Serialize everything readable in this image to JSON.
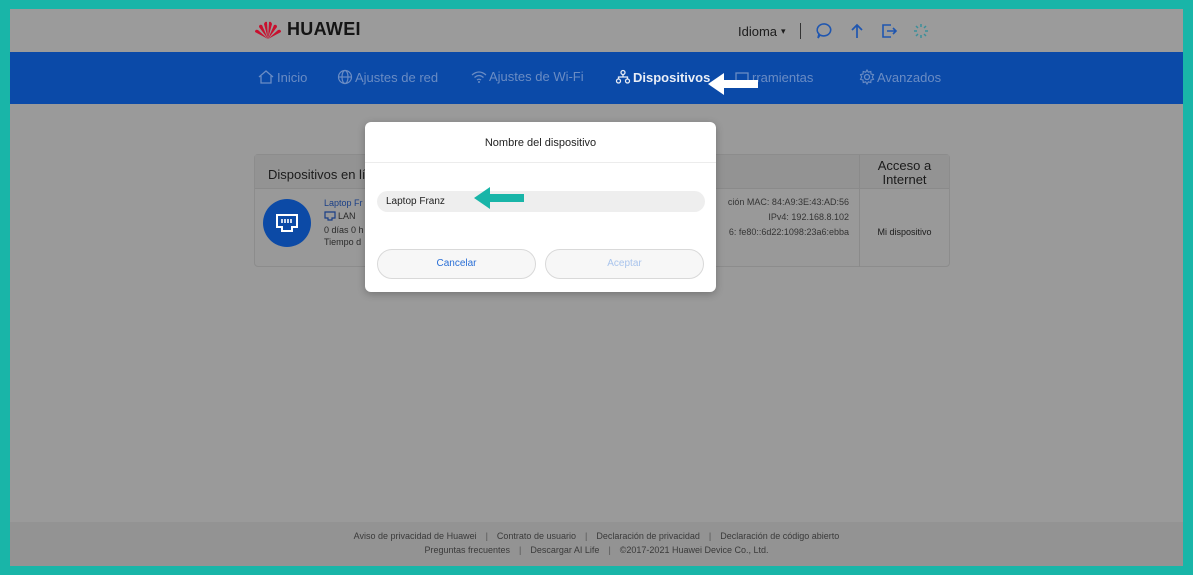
{
  "brand": {
    "name": "HUAWEI"
  },
  "topbar": {
    "language_label": "Idioma"
  },
  "nav": {
    "items": [
      {
        "label": "Inicio",
        "icon": "home-icon",
        "active": false
      },
      {
        "label": "Ajustes de red",
        "icon": "globe-icon",
        "active": false
      },
      {
        "label": "Ajustes de Wi-Fi",
        "icon": "wifi-icon",
        "active": false
      },
      {
        "label": "Dispositivos",
        "icon": "devices-icon",
        "active": true
      },
      {
        "label": "rramientas",
        "icon": "tools-icon",
        "active": false
      },
      {
        "label": "Avanzados",
        "icon": "gear-icon",
        "active": false
      }
    ]
  },
  "devices": {
    "title": "Dispositivos en lín",
    "access_header": "Acceso a Internet",
    "device": {
      "name": "Laptop Fr",
      "connection": "LAN",
      "uptime": "0 días 0 h",
      "since": "Tiempo d",
      "mac": "ción MAC: 84:A9:3E:43:AD:56",
      "ipv4": "IPv4: 192.168.8.102",
      "ipv6": "6: fe80::6d22:1098:23a6:ebba",
      "access": "Mi dispositivo"
    }
  },
  "dialog": {
    "title": "Nombre del dispositivo",
    "name_value": "Laptop Franz",
    "cancel_label": "Cancelar",
    "accept_label": "Aceptar"
  },
  "footer": {
    "line1": [
      "Aviso de privacidad de Huawei",
      "Contrato de usuario",
      "Declaración de privacidad",
      "Declaración de código abierto"
    ],
    "line2": [
      "Preguntas frecuentes",
      "Descargar AI Life",
      "©2017-2021 Huawei Device Co., Ltd."
    ]
  },
  "colors": {
    "nav_bg": "#0b4aa8",
    "accent": "#2a6fd6",
    "annotation_arrow": "#19b5a8",
    "brand_red": "#cf0a2c"
  }
}
